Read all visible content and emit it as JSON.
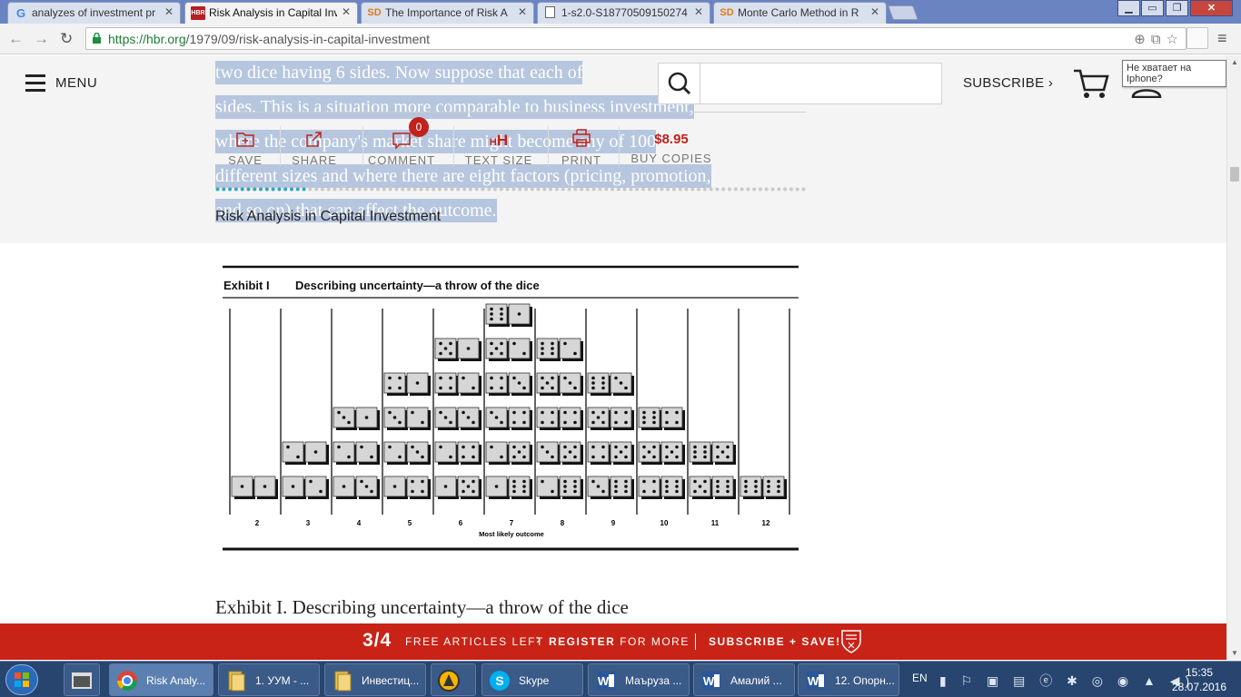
{
  "browser": {
    "tabs": [
      {
        "icon": "G",
        "label": "analyzes of investment pr",
        "active": false
      },
      {
        "icon": "HBR",
        "label": "Risk Analysis in Capital Inv",
        "active": true
      },
      {
        "icon": "SD",
        "label": "The Importance of Risk A",
        "active": false
      },
      {
        "icon": "doc",
        "label": "1-s2.0-S18770509150274",
        "active": false
      },
      {
        "icon": "SD",
        "label": "Monte Carlo Method in R",
        "active": false
      }
    ],
    "close_glyph": "✕",
    "url_host": "https://hbr.org",
    "url_path": "/1979/09/risk-analysis-in-capital-investment"
  },
  "page": {
    "ghost_lines": [
      "two dice having 6 sides. Now suppose that each of",
      "sides. This is a situation more comparable to business investment,",
      "where the company's market share might become any of 100",
      "different sizes and where there are eight factors (pricing, promotion,",
      "and so on) that can affect the outcome."
    ],
    "menu_label": "MENU",
    "search_placeholder": "",
    "subscribe_label": "SUBSCRIBE",
    "signin_label": "SIGN IN",
    "tooltip": "Не хватает на Iphone?",
    "tools": {
      "save": "SAVE",
      "share": "SHARE",
      "comment": "COMMENT",
      "comment_count": "0",
      "text_size": "TEXT SIZE",
      "text_size_icon_small": "H",
      "text_size_icon_big": "H",
      "print": "PRINT",
      "price": "$8.95",
      "buy": "BUY COPIES"
    },
    "reading_progress": 0.15,
    "article_title": "Risk Analysis in Capital Investment",
    "exhibit": {
      "label": "Exhibit I",
      "title": "Describing uncertainty—a throw of the dice",
      "caption": "Exhibit I. Describing uncertainty—a throw of the dice"
    }
  },
  "chart_data": {
    "type": "bar",
    "title": "Describing uncertainty—a throw of the dice",
    "categories": [
      "2",
      "3",
      "4",
      "5",
      "6",
      "7",
      "8",
      "9",
      "10",
      "11",
      "12"
    ],
    "values": [
      1,
      2,
      3,
      4,
      5,
      6,
      5,
      4,
      3,
      2,
      1
    ],
    "xlabel": "Most likely outcome",
    "ylabel": "",
    "mark": "pair of dice per combination",
    "ylim": [
      0,
      6
    ]
  },
  "promo": {
    "count": "3/4",
    "free_text": "FREE ARTICLES LEFT",
    "chevron": "›",
    "register_bold": "REGISTER",
    "register_rest": "FOR MORE",
    "subscribe": "SUBSCRIBE + SAVE!"
  },
  "taskbar": {
    "buttons": [
      {
        "label": "Risk Analy...",
        "icon": "chrome-icon",
        "active": true
      },
      {
        "label": "1. УУМ - ...",
        "icon": "folder-icon",
        "active": false
      },
      {
        "label": "Инвестиц...",
        "icon": "folder-icon",
        "active": false
      },
      {
        "label": "",
        "icon": "app-icon",
        "active": false
      },
      {
        "label": "Skype",
        "icon": "skype-icon",
        "active": false
      },
      {
        "label": "Маъруза ...",
        "icon": "word-icon",
        "active": false
      },
      {
        "label": "Амалий ...",
        "icon": "word-icon",
        "active": false
      },
      {
        "label": "12. Опорн...",
        "icon": "word-icon",
        "active": false
      }
    ],
    "lang": "EN",
    "time": "15:35",
    "date": "28.07.2016"
  },
  "colors": {
    "brand_red": "#c92216",
    "progress": "#2fa8b8",
    "taskbar": "#27456f",
    "tab_strip": "#6a84c2"
  }
}
